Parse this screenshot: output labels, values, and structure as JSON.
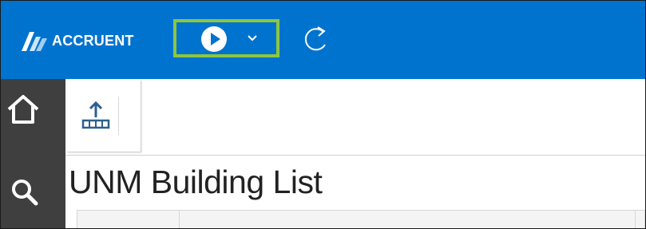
{
  "header": {
    "logo_text": "ACCRUENT",
    "brand_color": "#0073cf",
    "highlight_color": "#8dc63f",
    "run_button_icon": "play-icon",
    "run_dropdown_icon": "chevron-down-icon",
    "refresh_icon": "refresh-icon"
  },
  "sidebar": {
    "items": [
      {
        "icon": "home-icon"
      },
      {
        "icon": "search-icon"
      }
    ]
  },
  "toolbar": {
    "items": [
      {
        "icon": "upload-table-icon"
      }
    ]
  },
  "main": {
    "title": "UNM Building List"
  }
}
